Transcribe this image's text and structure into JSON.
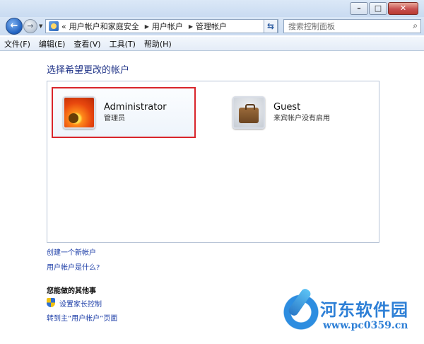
{
  "window": {
    "minimize_glyph": "–",
    "maximize_glyph": "□",
    "close_glyph": "✕"
  },
  "nav": {
    "back_glyph": "←",
    "forward_glyph": "→",
    "history_glyph": "▼",
    "overflow_glyph": "«",
    "breadcrumb": [
      "用户帐户和家庭安全",
      "用户帐户",
      "管理帐户"
    ],
    "breadcrumb_sep": "▶",
    "dropdown_glyph": "▼",
    "refresh_glyph": "⇆",
    "search_placeholder": "搜索控制面板",
    "search_glyph": "⌕"
  },
  "menu": [
    "文件(F)",
    "编辑(E)",
    "查看(V)",
    "工具(T)",
    "帮助(H)"
  ],
  "main": {
    "heading": "选择希望更改的帐户",
    "accounts": [
      {
        "name": "Administrator",
        "role": "管理员",
        "icon": "flower-avatar-icon",
        "selected": true
      },
      {
        "name": "Guest",
        "role": "来宾帐户没有启用",
        "icon": "suitcase-avatar-icon",
        "selected": false
      }
    ],
    "links": {
      "create": "创建一个新帐户",
      "what_is": "用户帐户是什么?"
    },
    "other": {
      "heading": "您能做的其他事",
      "parental": "设置家长控制",
      "goto_main": "转到主“用户帐户”页面"
    }
  },
  "watermark": {
    "name": "河东软件园",
    "url": "www.pc0359.cn"
  },
  "colors": {
    "selection_border": "#d9252b",
    "link": "#1e3fa8",
    "heading": "#1e3287",
    "watermark": "#2d7fd6"
  }
}
